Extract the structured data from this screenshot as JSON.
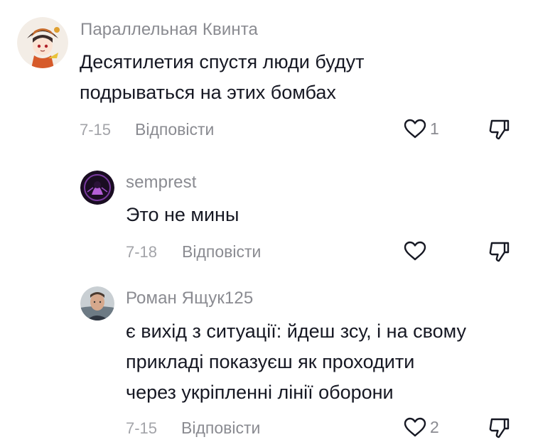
{
  "comments": [
    {
      "username": "Параллельная Квинта",
      "text_lines": [
        "Десятилетия спустя люди будут",
        "подрываться на этих бомбах"
      ],
      "date": "7-15",
      "reply_label": "Відповісти",
      "likes": "1",
      "avatar_icon": "anime-character-avatar"
    },
    {
      "username": "semprest",
      "text_lines": [
        "Это не мины"
      ],
      "date": "7-18",
      "reply_label": "Відповісти",
      "likes": "",
      "avatar_icon": "dark-purple-avatar"
    },
    {
      "username": "Роман Ящук125",
      "text_lines": [
        "є вихід з ситуації: йдеш зсу, і на свому",
        "прикладі показуєш як проходити",
        "через укріпленні лінії оборони"
      ],
      "date": "7-15",
      "reply_label": "Відповісти",
      "likes": "2",
      "avatar_icon": "man-photo-avatar"
    }
  ],
  "icons": {
    "like": "heart-outline-icon",
    "dislike": "thumbs-down-icon"
  },
  "colors": {
    "text": "#161823",
    "username": "#8a8b91",
    "meta": "#a3a4a9",
    "icon": "#161823"
  }
}
